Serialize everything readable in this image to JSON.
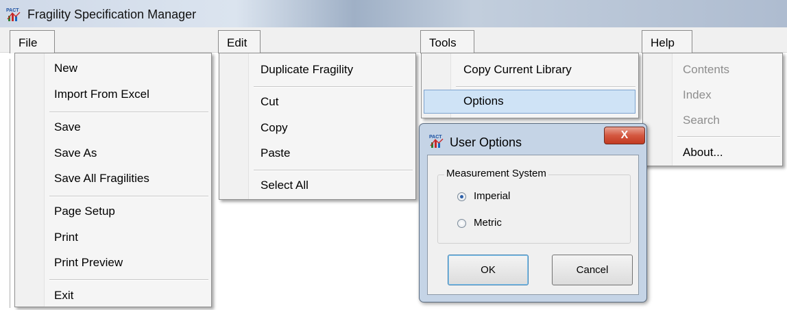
{
  "window": {
    "title": "Fragility Specification Manager",
    "app_icon": "pact-icon"
  },
  "menus": {
    "file": {
      "label": "File",
      "items": [
        "New",
        "Import From Excel",
        "Save",
        "Save As",
        "Save All Fragilities",
        "Page Setup",
        "Print",
        "Print Preview",
        "Exit"
      ]
    },
    "edit": {
      "label": "Edit",
      "items": [
        "Duplicate Fragility",
        "Cut",
        "Copy",
        "Paste",
        "Select All"
      ]
    },
    "tools": {
      "label": "Tools",
      "items": [
        "Copy Current Library",
        "Options"
      ],
      "highlighted": "Options"
    },
    "help": {
      "label": "Help",
      "items": [
        "Contents",
        "Index",
        "Search",
        "About..."
      ],
      "disabled": [
        "Contents",
        "Index",
        "Search"
      ]
    }
  },
  "dialog": {
    "title": "User Options",
    "close_glyph": "X",
    "group_label": "Measurement System",
    "options": [
      "Imperial",
      "Metric"
    ],
    "selected": "Imperial",
    "ok_label": "OK",
    "cancel_label": "Cancel"
  },
  "colors": {
    "highlight": "#cfe3f6",
    "close_button": "#c94a33",
    "dialog_frame": "#c5d4e6"
  }
}
